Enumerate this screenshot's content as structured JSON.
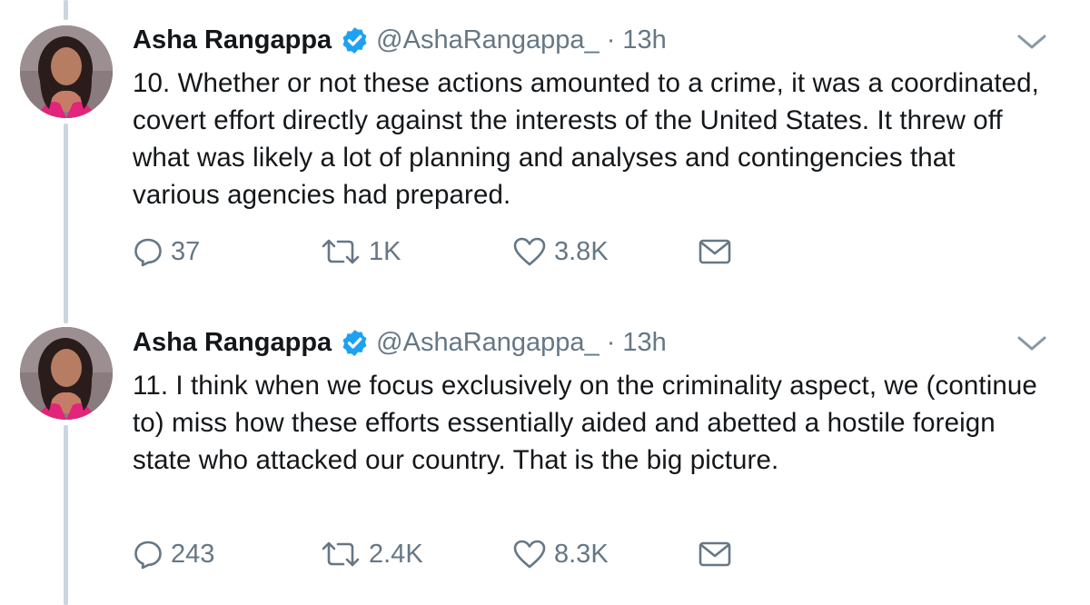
{
  "tweets": [
    {
      "name": "Asha Rangappa",
      "handle": "@AshaRangappa_",
      "separator": "·",
      "time": "13h",
      "text": "10. Whether or not these actions amounted to a crime, it was a coordinated, covert effort directly against the interests of the United States. It threw off what was likely a lot of planning and analyses and contingencies that various agencies had prepared.",
      "replies": "37",
      "retweets": "1K",
      "likes": "3.8K"
    },
    {
      "name": "Asha Rangappa",
      "handle": "@AshaRangappa_",
      "separator": "·",
      "time": "13h",
      "text": "11. I think when we focus exclusively on the criminality aspect, we (continue to) miss how these efforts essentially aided and abetted a hostile foreign state who attacked our country. That is the big picture.",
      "replies": "243",
      "retweets": "2.4K",
      "likes": "8.3K"
    }
  ],
  "icons": {
    "verified": "verified-badge-icon",
    "chevron": "chevron-down-icon",
    "reply": "reply-icon",
    "retweet": "retweet-icon",
    "like": "heart-icon",
    "message": "envelope-icon"
  },
  "colors": {
    "verified": "#1da1f2",
    "muted": "#657786",
    "text": "#14171a",
    "thread_line": "#ccd6dd"
  }
}
